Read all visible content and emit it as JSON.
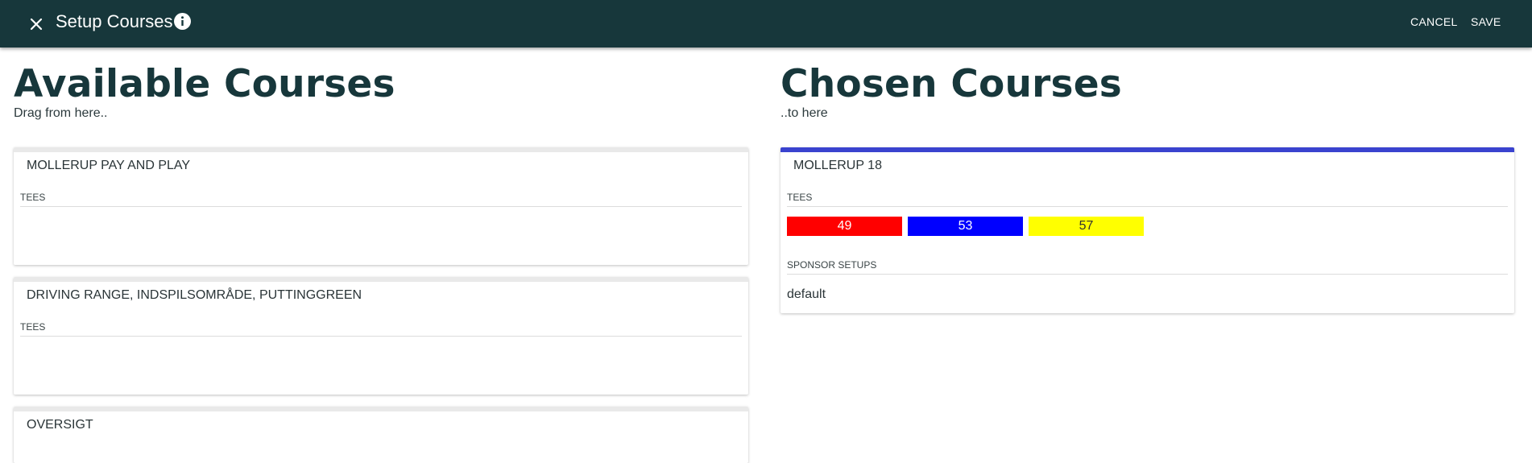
{
  "header": {
    "title": "Setup Courses",
    "cancel_label": "CANCEL",
    "save_label": "SAVE",
    "close_icon": "close-icon",
    "info_icon": "info-icon"
  },
  "available": {
    "title": "Available Courses",
    "subtitle": "Drag from here..",
    "courses": [
      {
        "name": "MOLLERUP PAY AND PLAY",
        "tees_label": "TEES"
      },
      {
        "name": "DRIVING RANGE, INDSPILSOMRÅDE, PUTTINGGREEN",
        "tees_label": "TEES"
      },
      {
        "name": "OVERSIGT"
      }
    ]
  },
  "chosen": {
    "title": "Chosen Courses",
    "subtitle": "..to here",
    "courses": [
      {
        "name": "MOLLERUP 18",
        "tees_label": "TEES",
        "tees": [
          {
            "value": "49",
            "bg": "#ff0000",
            "fg": "#ffffff"
          },
          {
            "value": "53",
            "bg": "#0000ff",
            "fg": "#ffffff"
          },
          {
            "value": "57",
            "bg": "#ffff00",
            "fg": "#333333"
          }
        ],
        "sponsor_label": "SPONSOR SETUPS",
        "sponsor_value": "default"
      }
    ]
  },
  "colors": {
    "header_bg": "#17373b",
    "accent": "#3a43cf",
    "title_color": "#17373b"
  }
}
